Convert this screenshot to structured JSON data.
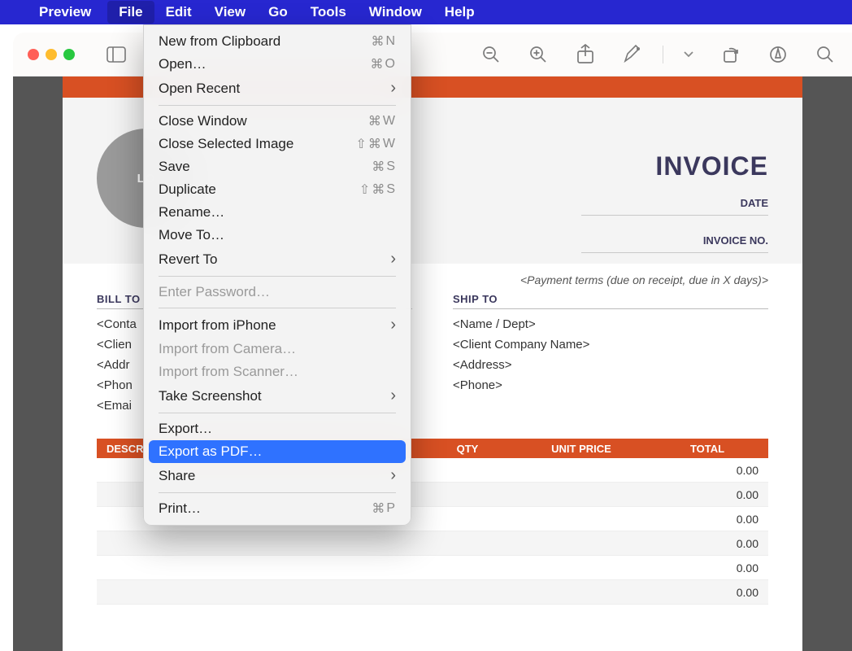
{
  "menubar": {
    "app": "Preview",
    "items": [
      "File",
      "Edit",
      "View",
      "Go",
      "Tools",
      "Window",
      "Help"
    ],
    "active": "File"
  },
  "file_menu": [
    {
      "label": "New from Clipboard",
      "shortcut": "⌘ N",
      "enabled": true
    },
    {
      "label": "Open…",
      "shortcut": "⌘ O",
      "enabled": true
    },
    {
      "label": "Open Recent",
      "submenu": true,
      "enabled": true
    },
    {
      "sep": true
    },
    {
      "label": "Close Window",
      "shortcut": "⌘ W",
      "enabled": true
    },
    {
      "label": "Close Selected Image",
      "shortcut": "⇧ ⌘ W",
      "enabled": true
    },
    {
      "label": "Save",
      "shortcut": "⌘ S",
      "enabled": true
    },
    {
      "label": "Duplicate",
      "shortcut": "⇧ ⌘ S",
      "enabled": true
    },
    {
      "label": "Rename…",
      "enabled": true
    },
    {
      "label": "Move To…",
      "enabled": true
    },
    {
      "label": "Revert To",
      "submenu": true,
      "enabled": true
    },
    {
      "sep": true
    },
    {
      "label": "Enter Password…",
      "enabled": false
    },
    {
      "sep": true
    },
    {
      "label": "Import from iPhone",
      "submenu": true,
      "enabled": true
    },
    {
      "label": "Import from Camera…",
      "enabled": false
    },
    {
      "label": "Import from Scanner…",
      "enabled": false
    },
    {
      "label": "Take Screenshot",
      "submenu": true,
      "enabled": true
    },
    {
      "sep": true
    },
    {
      "label": "Export…",
      "enabled": true
    },
    {
      "label": "Export as PDF…",
      "enabled": true,
      "highlight": true
    },
    {
      "label": "Share",
      "submenu": true,
      "enabled": true
    },
    {
      "sep": true
    },
    {
      "label": "Print…",
      "shortcut": "⌘ P",
      "enabled": true
    }
  ],
  "toolbar_icons": [
    "sidebar-icon",
    "zoom-out-icon",
    "zoom-in-icon",
    "share-icon",
    "markup-icon",
    "rotate-icon",
    "inspect-icon",
    "search-icon"
  ],
  "document": {
    "logo_text": "LO",
    "title": "INVOICE",
    "meta": {
      "date_label": "DATE",
      "invoice_label": "INVOICE NO."
    },
    "payment_terms": "<Payment terms (due on receipt, due in X days)>",
    "bill_to": {
      "heading": "BILL TO",
      "lines": [
        "<Conta",
        "<Clien",
        "<Addr",
        "<Phon",
        "<Emai"
      ]
    },
    "ship_to": {
      "heading": "SHIP TO",
      "lines": [
        "<Name / Dept>",
        "<Client Company Name>",
        "<Address>",
        "<Phone>"
      ]
    },
    "table": {
      "headers": {
        "desc": "DESCRIPTION",
        "qty": "QTY",
        "unit": "UNIT PRICE",
        "total": "TOTAL"
      },
      "rows": [
        {
          "total": "0.00"
        },
        {
          "total": "0.00"
        },
        {
          "total": "0.00"
        },
        {
          "total": "0.00"
        },
        {
          "total": "0.00"
        },
        {
          "total": "0.00"
        }
      ]
    }
  }
}
